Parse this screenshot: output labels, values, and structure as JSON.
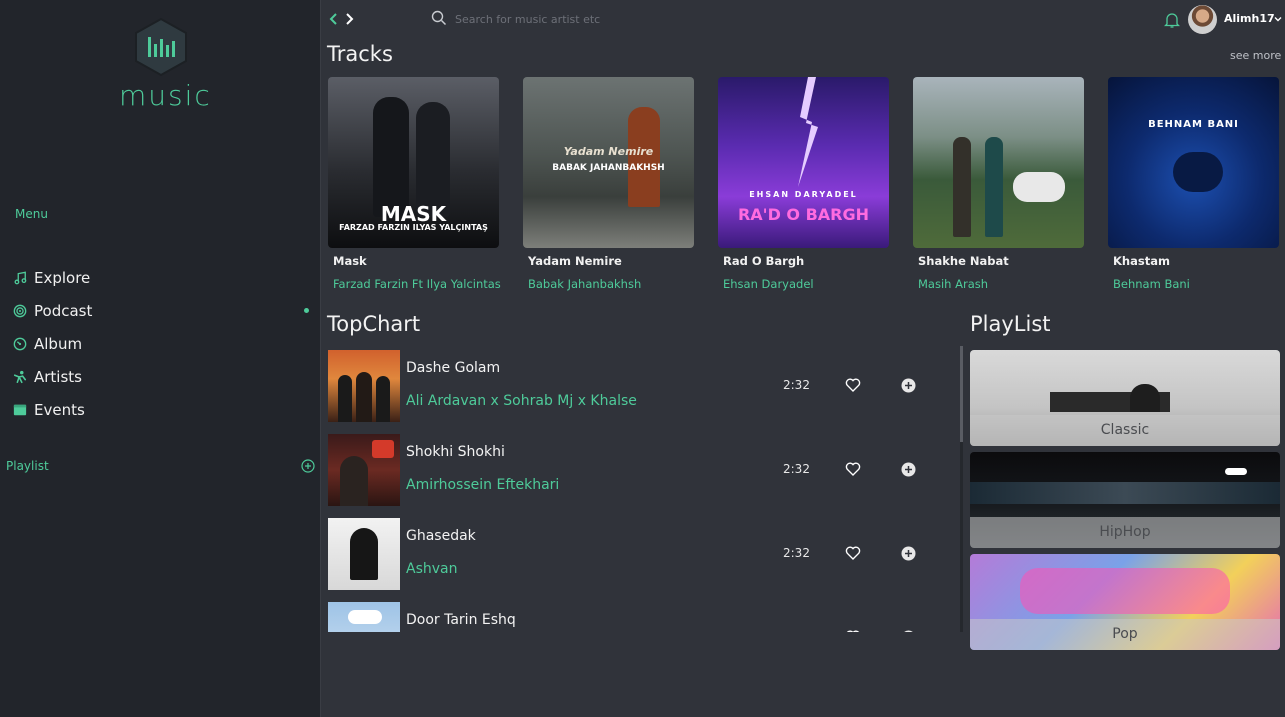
{
  "brand": {
    "name": "music"
  },
  "sidebar": {
    "menu_label": "Menu",
    "items": [
      {
        "label": "Explore",
        "icon": "music-note-icon"
      },
      {
        "label": "Podcast",
        "icon": "podcast-icon"
      },
      {
        "label": "Album",
        "icon": "album-icon"
      },
      {
        "label": "Artists",
        "icon": "artist-icon"
      },
      {
        "label": "Events",
        "icon": "calendar-icon"
      }
    ],
    "playlist_label": "Playlist"
  },
  "topbar": {
    "search_placeholder": "Search for music artist etc",
    "username": "Alimh17"
  },
  "tracks": {
    "title": "Tracks",
    "see_more": "see more",
    "items": [
      {
        "name": "Mask",
        "artist": "Farzad Farzin Ft Ilya Yalcintas",
        "cover_text": "MASK",
        "cover_subtext": "FARZAD FARZIN  ILYAS YALÇINTAŞ"
      },
      {
        "name": "Yadam Nemire",
        "artist": "Babak Jahanbakhsh",
        "cover_text": "BABAK JAHANBAKHSH",
        "cover_subtext": "Yadam Nemire"
      },
      {
        "name": "Rad O Bargh",
        "artist": "Ehsan Daryadel",
        "cover_text": "RA'D O BARGH",
        "cover_subtext": "EHSAN DARYADEL"
      },
      {
        "name": "Shakhe Nabat",
        "artist": "Masih Arash",
        "cover_text": "",
        "cover_subtext": ""
      },
      {
        "name": "Khastam",
        "artist": "Behnam Bani",
        "cover_text": "BEHNAM BANI",
        "cover_subtext": ""
      }
    ]
  },
  "topchart": {
    "title": "TopChart",
    "rows": [
      {
        "title": "Dashe Golam",
        "artist": "Ali Ardavan x Sohrab Mj x Khalse",
        "time": "2:32"
      },
      {
        "title": "Shokhi Shokhi",
        "artist": "Amirhossein Eftekhari",
        "time": "2:32"
      },
      {
        "title": "Ghasedak",
        "artist": "Ashvan",
        "time": "2:32"
      },
      {
        "title": "Door Tarin Eshq",
        "artist": "",
        "time": ""
      }
    ]
  },
  "playlist": {
    "title": "PlayList",
    "items": [
      {
        "label": "Classic"
      },
      {
        "label": "HipHop"
      },
      {
        "label": "Pop"
      }
    ]
  },
  "colors": {
    "accent": "#4ecb9a",
    "sidebar_bg": "#22252b",
    "main_bg": "#30333a"
  }
}
